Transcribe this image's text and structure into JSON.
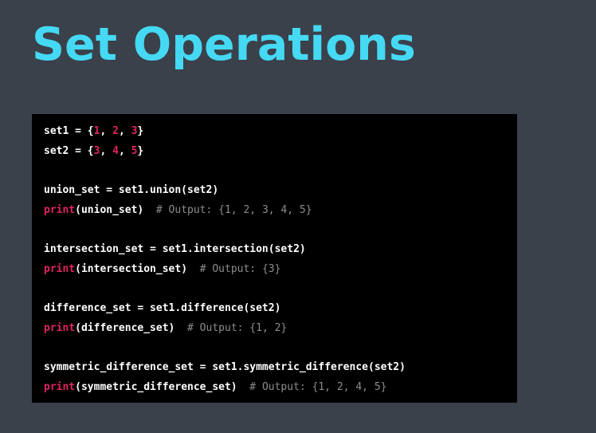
{
  "title": "Set Operations",
  "code": {
    "lines": [
      [
        {
          "t": "plain",
          "v": "set1 = {"
        },
        {
          "t": "num",
          "v": "1"
        },
        {
          "t": "plain",
          "v": ", "
        },
        {
          "t": "num",
          "v": "2"
        },
        {
          "t": "plain",
          "v": ", "
        },
        {
          "t": "num",
          "v": "3"
        },
        {
          "t": "plain",
          "v": "}"
        }
      ],
      [
        {
          "t": "plain",
          "v": "set2 = {"
        },
        {
          "t": "num",
          "v": "3"
        },
        {
          "t": "plain",
          "v": ", "
        },
        {
          "t": "num",
          "v": "4"
        },
        {
          "t": "plain",
          "v": ", "
        },
        {
          "t": "num",
          "v": "5"
        },
        {
          "t": "plain",
          "v": "}"
        }
      ],
      [],
      [
        {
          "t": "plain",
          "v": "union_set = set1.union(set2)"
        }
      ],
      [
        {
          "t": "builtin",
          "v": "print"
        },
        {
          "t": "plain",
          "v": "(union_set)  "
        },
        {
          "t": "comment",
          "v": "# Output: {1, 2, 3, 4, 5}"
        }
      ],
      [],
      [
        {
          "t": "plain",
          "v": "intersection_set = set1.intersection(set2)"
        }
      ],
      [
        {
          "t": "builtin",
          "v": "print"
        },
        {
          "t": "plain",
          "v": "(intersection_set)  "
        },
        {
          "t": "comment",
          "v": "# Output: {3}"
        }
      ],
      [],
      [
        {
          "t": "plain",
          "v": "difference_set = set1.difference(set2)"
        }
      ],
      [
        {
          "t": "builtin",
          "v": "print"
        },
        {
          "t": "plain",
          "v": "(difference_set)  "
        },
        {
          "t": "comment",
          "v": "# Output: {1, 2}"
        }
      ],
      [],
      [
        {
          "t": "plain",
          "v": "symmetric_difference_set = set1.symmetric_difference(set2)"
        }
      ],
      [
        {
          "t": "builtin",
          "v": "print"
        },
        {
          "t": "plain",
          "v": "(symmetric_difference_set)  "
        },
        {
          "t": "comment",
          "v": "# Output: {1, 2, 4, 5}"
        }
      ]
    ]
  }
}
